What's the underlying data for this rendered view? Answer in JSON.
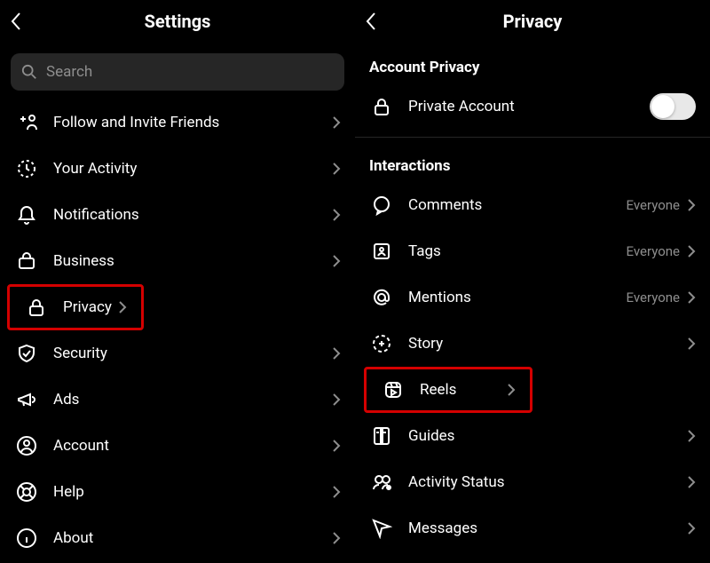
{
  "left": {
    "title": "Settings",
    "search_placeholder": "Search",
    "items": [
      {
        "label": "Follow and Invite Friends"
      },
      {
        "label": "Your Activity"
      },
      {
        "label": "Notifications"
      },
      {
        "label": "Business"
      },
      {
        "label": "Privacy"
      },
      {
        "label": "Security"
      },
      {
        "label": "Ads"
      },
      {
        "label": "Account"
      },
      {
        "label": "Help"
      },
      {
        "label": "About"
      }
    ]
  },
  "right": {
    "title": "Privacy",
    "section1": "Account Privacy",
    "private_account": "Private Account",
    "private_account_on": false,
    "section2": "Interactions",
    "items": [
      {
        "label": "Comments",
        "value": "Everyone"
      },
      {
        "label": "Tags",
        "value": "Everyone"
      },
      {
        "label": "Mentions",
        "value": "Everyone"
      },
      {
        "label": "Story"
      },
      {
        "label": "Reels"
      },
      {
        "label": "Guides"
      },
      {
        "label": "Activity Status"
      },
      {
        "label": "Messages"
      }
    ]
  }
}
